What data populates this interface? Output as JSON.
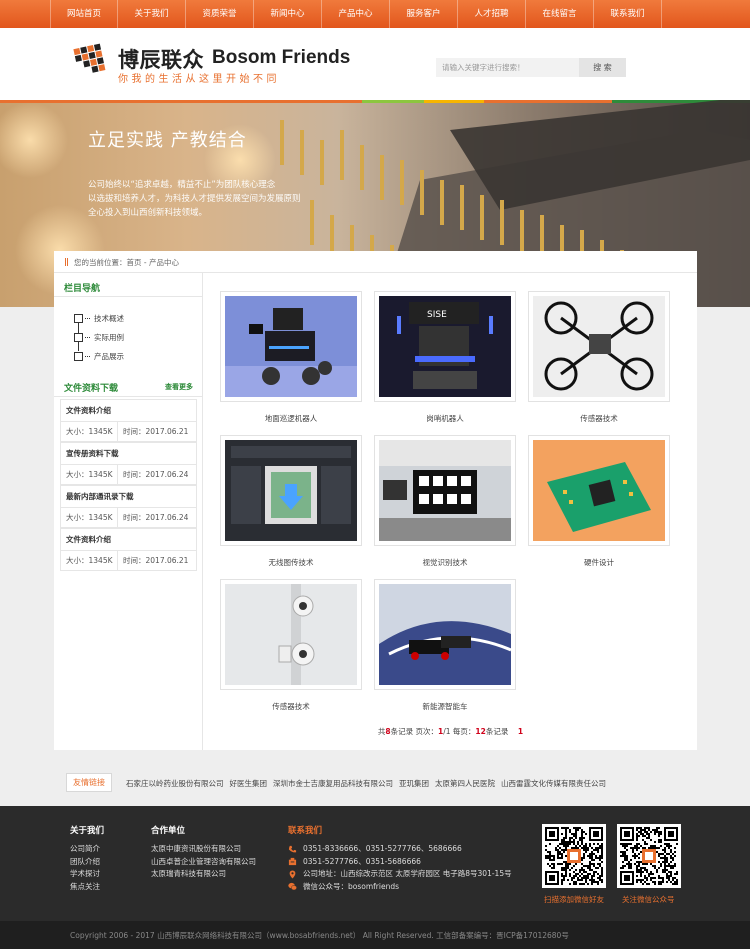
{
  "nav": [
    "网站首页",
    "关于我们",
    "资质荣誉",
    "新闻中心",
    "产品中心",
    "服务客户",
    "人才招聘",
    "在线留言",
    "联系我们"
  ],
  "header": {
    "logo_cn": "博辰联众",
    "logo_en": "Bosom Friends",
    "slogan": "你我的生活从这里开始不同",
    "search_placeholder": "请输入关键字进行搜索！",
    "search_button": "搜 索"
  },
  "banner": {
    "title": "立足实践  产教结合",
    "lines": [
      "公司始终以“追求卓越，精益不止”为团队核心理念",
      "以选拔和培养人才，为科技人才提供发展空间为发展原则",
      "全心投入到山西创新科技领域。"
    ]
  },
  "breadcrumb": "您的当前位置：首页 - 产品中心",
  "sidebar": {
    "nav_title": "栏目导航",
    "nav_items": [
      "技术概述",
      "实际用例",
      "产品展示"
    ],
    "download_title": "文件资料下载",
    "more": "查看更多",
    "downloads": [
      {
        "name": "文件资料介绍",
        "size": "大小：1345K",
        "time": "时间：2017.06.21"
      },
      {
        "name": "宣传册资料下载",
        "size": "大小：1345K",
        "time": "时间：2017.06.24"
      },
      {
        "name": "最新内部通讯录下载",
        "size": "大小：1345K",
        "time": "时间：2017.06.24"
      },
      {
        "name": "文件资料介绍",
        "size": "大小：1345K",
        "time": "时间：2017.06.21"
      }
    ]
  },
  "products": [
    {
      "caption": "地面巡逻机器人",
      "icon": "robot-car-photo"
    },
    {
      "caption": "岗哨机器人",
      "icon": "sentry-robot-photo"
    },
    {
      "caption": "传感器技术",
      "icon": "quadcopter-photo"
    },
    {
      "caption": "无线图传技术",
      "icon": "software-screen-photo"
    },
    {
      "caption": "视觉识别技术",
      "icon": "vision-lab-photo"
    },
    {
      "caption": "硬件设计",
      "icon": "circuit-board-photo"
    },
    {
      "caption": "传感器技术",
      "icon": "sensor-photo"
    },
    {
      "caption": "新能源智能车",
      "icon": "smart-car-track-photo"
    }
  ],
  "pager": {
    "prefix": "共",
    "total": "8",
    "mid1": "条记录  页次：",
    "page": "1",
    "sep": "/1 每页：",
    "per": "12",
    "suffix": "条记录",
    "current": "1"
  },
  "links": {
    "label": "友情链接",
    "items": [
      "石家庄以岭药业股份有限公司",
      "好医生集团",
      "深圳市金士吉康复用品科技有限公司",
      "亚玑集团",
      "太原第四人民医院",
      "山西雷霆文化传媒有限责任公司"
    ]
  },
  "footer": {
    "about_title": "关于我们",
    "about_items": [
      "公司简介",
      "团队介绍",
      "学术探讨",
      "焦点关注"
    ],
    "partners_title": "合作单位",
    "partners": [
      "太原中康资讯股份有限公司",
      "山西卓普企业管理咨询有限公司",
      "太原瑞青科技有限公司"
    ],
    "contact_title": "联系我们",
    "contact": [
      {
        "icon": "phone-icon",
        "text": "0351-8336666、0351-5277766、5686666"
      },
      {
        "icon": "fax-icon",
        "text": "0351-5277766、0351-5686666"
      },
      {
        "icon": "location-icon",
        "text": "公司地址：山西综改示范区 太原学府园区 电子路8号301-15号"
      },
      {
        "icon": "wechat-icon",
        "text": "微信公众号：bosomfriends"
      }
    ],
    "qr1_caption": "扫描添加微信好友",
    "qr2_caption": "关注微信公众号",
    "copyright": "Copyright 2006 - 2017  山西博辰联众网络科技有限公司（www.bosabfriends.net）  All Right Reserved.    工信部备案编号：晋ICP备17012680号"
  },
  "colors": {
    "accent": "#e8702f",
    "green": "#2e8b3a",
    "dark": "#2b2b2b"
  }
}
